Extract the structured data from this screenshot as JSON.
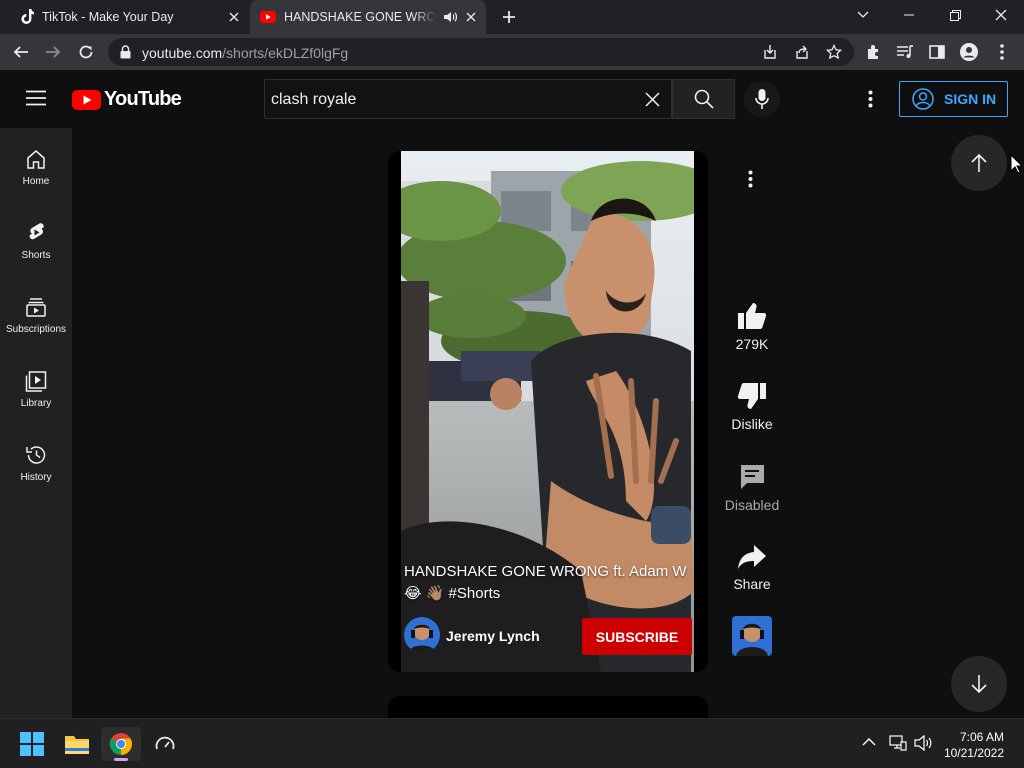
{
  "browser": {
    "tabs": [
      {
        "title": "TikTok - Make Your Day",
        "active": false
      },
      {
        "title": "HANDSHAKE GONE WRONG ft. Adam W 😂 👋🏽 #Shorts",
        "active": true
      }
    ],
    "new_tab_label": "+",
    "url_host": "youtube.com",
    "url_path": "/shorts/ekDLZf0lgFg"
  },
  "header": {
    "logo_text": "YouTube",
    "search_value": "clash royale",
    "sign_in_label": "SIGN IN"
  },
  "sidebar": {
    "items": [
      {
        "label": "Home",
        "icon": "home-icon"
      },
      {
        "label": "Shorts",
        "icon": "shorts-icon"
      },
      {
        "label": "Subscriptions",
        "icon": "subscriptions-icon"
      },
      {
        "label": "Library",
        "icon": "library-icon"
      },
      {
        "label": "History",
        "icon": "history-icon"
      }
    ]
  },
  "short": {
    "title_line1": "HANDSHAKE GONE WRONG ft. Adam W",
    "title_line2": "😂 👋🏽 #Shorts",
    "channel_name": "Jeremy Lynch",
    "subscribe_label": "SUBSCRIBE",
    "actions": {
      "like_count": "279K",
      "dislike_label": "Dislike",
      "comments_label": "Disabled",
      "share_label": "Share"
    }
  },
  "taskbar": {
    "time": "7:06 AM",
    "date": "10/21/2022"
  },
  "colors": {
    "yt_red": "#ff0000",
    "subscribe_red": "#cc0000",
    "sign_in_blue": "#3ea6ff"
  }
}
